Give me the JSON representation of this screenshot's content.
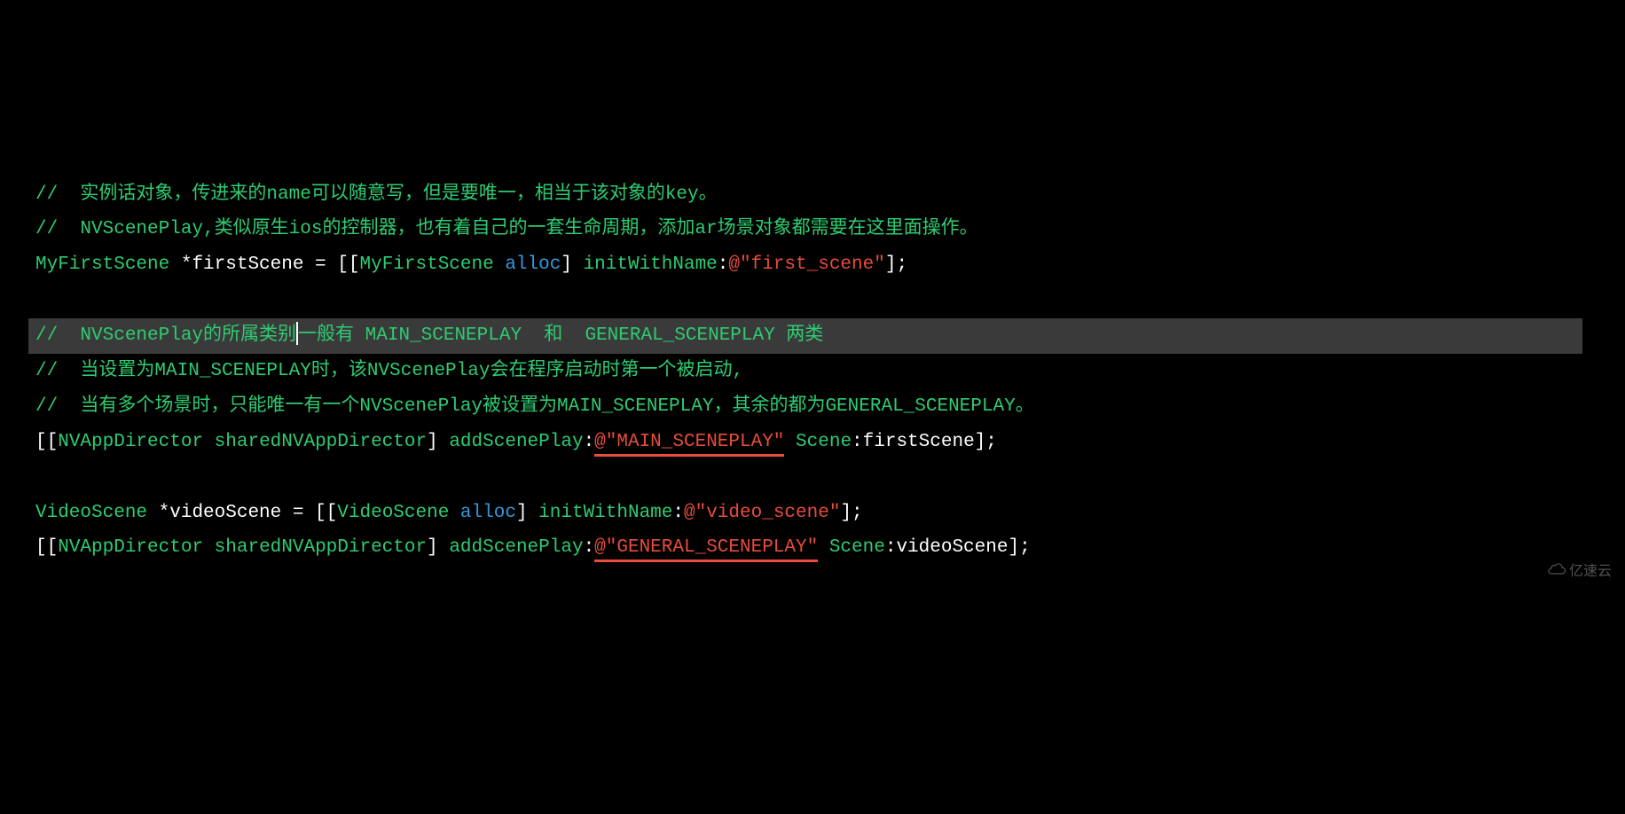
{
  "code": {
    "lines": [
      {
        "type": "comment",
        "text": "//  实例话对象，传进来的name可以随意写，但是要唯一，相当于该对象的key。"
      },
      {
        "type": "comment",
        "text": "//  NVScenePlay,类似原生ios的控制器，也有着自己的一套生命周期，添加ar场景对象都需要在这里面操作。"
      },
      {
        "type": "code",
        "tokens": [
          {
            "class": "type",
            "text": "MyFirstScene"
          },
          {
            "class": "text",
            "text": " *firstScene = [["
          },
          {
            "class": "type",
            "text": "MyFirstScene"
          },
          {
            "class": "text",
            "text": " "
          },
          {
            "class": "keyword",
            "text": "alloc"
          },
          {
            "class": "text",
            "text": "] "
          },
          {
            "class": "method",
            "text": "initWithName"
          },
          {
            "class": "text",
            "text": ":"
          },
          {
            "class": "string",
            "text": "@\"first_scene\""
          },
          {
            "class": "text",
            "text": "];"
          }
        ]
      },
      {
        "type": "blank"
      },
      {
        "type": "comment-highlighted",
        "text": "//  NVScenePlay的所属类别一般有 MAIN_SCENEPLAY  和  GENERAL_SCENEPLAY 两类"
      },
      {
        "type": "comment",
        "text": "//  当设置为MAIN_SCENEPLAY时，该NVScenePlay会在程序启动时第一个被启动,"
      },
      {
        "type": "comment",
        "text": "//  当有多个场景时，只能唯一有一个NVScenePlay被设置为MAIN_SCENEPLAY，其余的都为GENERAL_SCENEPLAY。"
      },
      {
        "type": "code",
        "tokens": [
          {
            "class": "text",
            "text": "[["
          },
          {
            "class": "type",
            "text": "NVAppDirector"
          },
          {
            "class": "text",
            "text": " "
          },
          {
            "class": "method",
            "text": "sharedNVAppDirector"
          },
          {
            "class": "text",
            "text": "] "
          },
          {
            "class": "method",
            "text": "addScenePlay"
          },
          {
            "class": "text",
            "text": ":"
          },
          {
            "class": "string",
            "text": "@\"MAIN_SCENEPLAY\"",
            "underline": true
          },
          {
            "class": "text",
            "text": " "
          },
          {
            "class": "method",
            "text": "Scene"
          },
          {
            "class": "text",
            "text": ":firstScene];"
          }
        ]
      },
      {
        "type": "blank"
      },
      {
        "type": "code",
        "tokens": [
          {
            "class": "type",
            "text": "VideoScene"
          },
          {
            "class": "text",
            "text": " *videoScene = [["
          },
          {
            "class": "type",
            "text": "VideoScene"
          },
          {
            "class": "text",
            "text": " "
          },
          {
            "class": "keyword",
            "text": "alloc"
          },
          {
            "class": "text",
            "text": "] "
          },
          {
            "class": "method",
            "text": "initWithName"
          },
          {
            "class": "text",
            "text": ":"
          },
          {
            "class": "string",
            "text": "@\"video_scene\""
          },
          {
            "class": "text",
            "text": "];"
          }
        ]
      },
      {
        "type": "code",
        "tokens": [
          {
            "class": "text",
            "text": "[["
          },
          {
            "class": "type",
            "text": "NVAppDirector"
          },
          {
            "class": "text",
            "text": " "
          },
          {
            "class": "method",
            "text": "sharedNVAppDirector"
          },
          {
            "class": "text",
            "text": "] "
          },
          {
            "class": "method",
            "text": "addScenePlay"
          },
          {
            "class": "text",
            "text": ":"
          },
          {
            "class": "string",
            "text": "@\"GENERAL_SCENEPLAY\"",
            "underline": true
          },
          {
            "class": "text",
            "text": " "
          },
          {
            "class": "method",
            "text": "Scene"
          },
          {
            "class": "text",
            "text": ":videoScene];"
          }
        ]
      }
    ]
  },
  "watermark": "亿速云"
}
